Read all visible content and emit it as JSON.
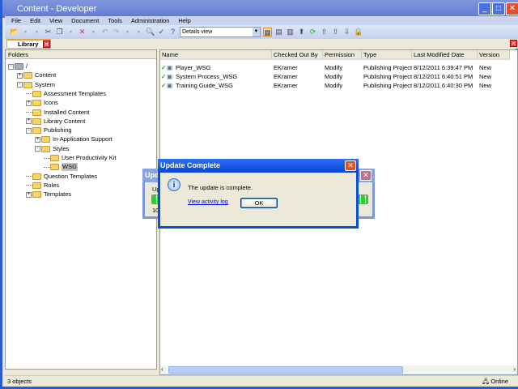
{
  "window": {
    "title": "Content - Developer"
  },
  "menu": [
    "File",
    "Edit",
    "View",
    "Document",
    "Tools",
    "Administration",
    "Help"
  ],
  "toolbar": {
    "view_select": "Details view"
  },
  "tab": {
    "label": "Library"
  },
  "folders": {
    "header": "Folders",
    "tree": [
      {
        "label": "/",
        "depth": 0,
        "exp": "-"
      },
      {
        "label": "Content",
        "depth": 1,
        "exp": "+"
      },
      {
        "label": "System",
        "depth": 1,
        "exp": "-"
      },
      {
        "label": "Assessment Templates",
        "depth": 2,
        "exp": ""
      },
      {
        "label": "Icons",
        "depth": 2,
        "exp": "+"
      },
      {
        "label": "Installed Content",
        "depth": 2,
        "exp": ""
      },
      {
        "label": "Library Content",
        "depth": 2,
        "exp": "+"
      },
      {
        "label": "Publishing",
        "depth": 2,
        "exp": "-"
      },
      {
        "label": "In-Application Support",
        "depth": 3,
        "exp": "+"
      },
      {
        "label": "Styles",
        "depth": 3,
        "exp": "-"
      },
      {
        "label": "User Productivity Kit",
        "depth": 4,
        "exp": ""
      },
      {
        "label": "WSG",
        "depth": 4,
        "exp": "",
        "selected": true
      },
      {
        "label": "Question Templates",
        "depth": 2,
        "exp": ""
      },
      {
        "label": "Roles",
        "depth": 2,
        "exp": ""
      },
      {
        "label": "Templates",
        "depth": 2,
        "exp": "+"
      }
    ]
  },
  "list": {
    "columns": [
      "Name",
      "Checked Out By",
      "Permission",
      "Type",
      "Last Modified Date",
      "Version"
    ],
    "rows": [
      [
        "Player_WSG",
        "EKramer",
        "Modify",
        "Publishing Project",
        "8/12/2011 6:39:47 PM",
        "New"
      ],
      [
        "System Process_WSG",
        "EKramer",
        "Modify",
        "Publishing Project",
        "8/12/2011 6:40:51 PM",
        "New"
      ],
      [
        "Training Guide_WSG",
        "EKramer",
        "Modify",
        "Publishing Project",
        "8/12/2011 6:40:30 PM",
        "New"
      ]
    ]
  },
  "status": {
    "count": "3 objects",
    "connection": "Online"
  },
  "back_dialog": {
    "title": "Upd",
    "label": "Up",
    "progress_text": "10",
    "progress": 1.0
  },
  "dialog": {
    "title": "Update Complete",
    "message": "The update is complete.",
    "link": "View activity log",
    "ok": "OK",
    "icon": "info-icon"
  }
}
